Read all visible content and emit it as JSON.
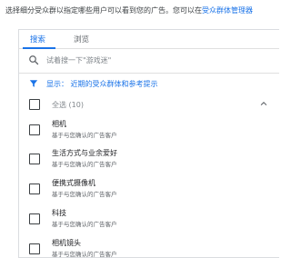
{
  "intro": {
    "text": "选择细分受众群以指定哪些用户可以看到您的广告。您可以在",
    "link": "受众群体管理器"
  },
  "tabs": [
    {
      "label": "搜索",
      "active": true
    },
    {
      "label": "浏览",
      "active": false
    }
  ],
  "search": {
    "placeholder": "试着搜一下\"游戏迷\"",
    "icon": "search-icon"
  },
  "filter": {
    "label": "显示： 近期的受众群体和参考提示",
    "icon": "filter-icon",
    "color": "#1a73e8"
  },
  "all": {
    "label": "全选 (10)",
    "expanded": true
  },
  "items": [
    {
      "label": "相机",
      "sub": "基于与您确认的广告客户"
    },
    {
      "label": "生活方式与业余爱好",
      "sub": "基于与您确认的广告客户"
    },
    {
      "label": "便携式摄像机",
      "sub": "基于与您确认的广告客户"
    },
    {
      "label": "科技",
      "sub": "基于与您确认的广告客户"
    },
    {
      "label": "相机镜头",
      "sub": "基于与您确认的广告客户"
    }
  ],
  "colors": {
    "accent": "#1a73e8",
    "text": "#202124",
    "secondary": "#5f6368",
    "border": "#dadce0"
  }
}
